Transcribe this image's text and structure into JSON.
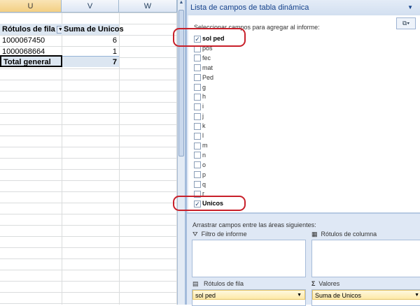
{
  "sheet": {
    "columns": [
      "U",
      "V",
      "W"
    ],
    "pivot": {
      "header_row_label": "Rótulos de fila",
      "header_value_label": "Suma de Unicos",
      "rows": [
        {
          "label": "1000067450",
          "value": "6"
        },
        {
          "label": "1000068664",
          "value": "1"
        }
      ],
      "total_label": "Total general",
      "total_value": "7"
    }
  },
  "panel": {
    "title": "Lista de campos de tabla dinámica",
    "select_label": "Seleccionar campos para agregar al informe:",
    "fields": [
      {
        "name": "sol ped",
        "checked": true
      },
      {
        "name": "pos",
        "checked": false
      },
      {
        "name": "fec",
        "checked": false
      },
      {
        "name": "mat",
        "checked": false
      },
      {
        "name": "Ped",
        "checked": false
      },
      {
        "name": "g",
        "checked": false
      },
      {
        "name": "h",
        "checked": false
      },
      {
        "name": "i",
        "checked": false
      },
      {
        "name": "j",
        "checked": false
      },
      {
        "name": "k",
        "checked": false
      },
      {
        "name": "l",
        "checked": false
      },
      {
        "name": "m",
        "checked": false
      },
      {
        "name": "n",
        "checked": false
      },
      {
        "name": "o",
        "checked": false
      },
      {
        "name": "p",
        "checked": false
      },
      {
        "name": "q",
        "checked": false
      },
      {
        "name": "r",
        "checked": false
      },
      {
        "name": "Unicos",
        "checked": true
      }
    ],
    "drag_label": "Arrastrar campos entre las áreas siguientes:",
    "areas": {
      "filter": "Filtro de informe",
      "columns": "Rótulos de columna",
      "rows": "Rótulos de fila",
      "values": "Valores"
    },
    "row_field": "sol ped",
    "value_field": "Suma de Unicos"
  },
  "colors": {
    "highlight_oval": "#c8202a"
  }
}
